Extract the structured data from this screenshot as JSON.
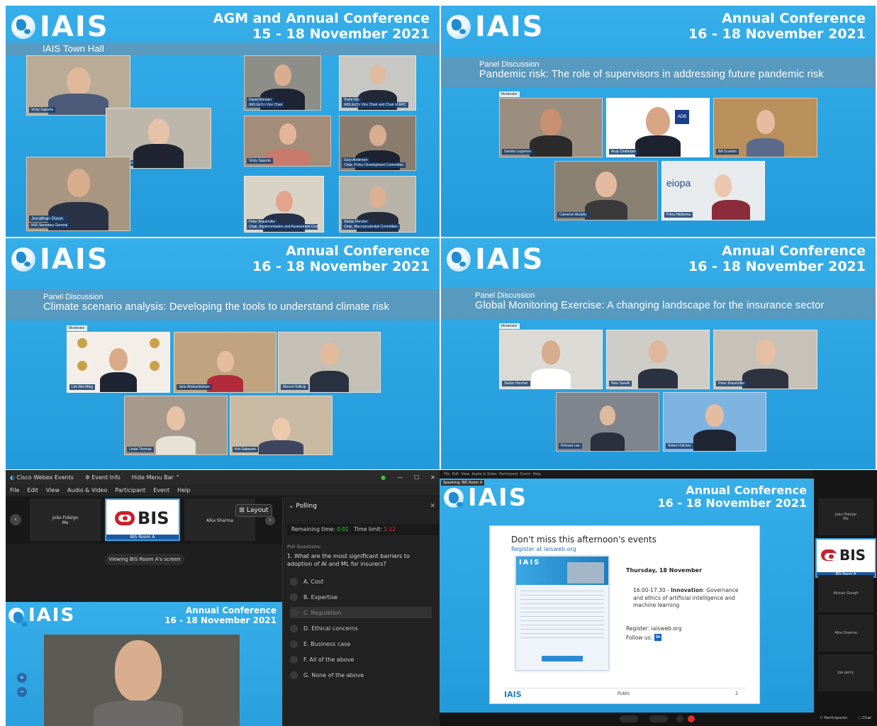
{
  "colors": {
    "brand_blue": "#2fa6e4",
    "caption_blue": "#143c6e",
    "bis_red": "#c8202c",
    "webex_dark": "#1e1e1e"
  },
  "logo": "IAIS",
  "panels": [
    {
      "conf_line1": "AGM and Annual Conference",
      "conf_line2": "15 - 18 November 2021",
      "band_title": "IAIS Town Hall",
      "tiles": [
        {
          "cap": "Vicky Saporta"
        },
        {
          "cap": "Rutger Zijlstra"
        },
        {
          "cap": "Jonathan Dixon",
          "cap2": "IAIS Secretary General"
        },
        {
          "cap": "David Altmaier",
          "cap2": "IAIS ExCo Vice Chair"
        },
        {
          "cap": "Yoshi Ota",
          "cap2": "IAIS ExCo Vice Chair and Chair of ARC"
        },
        {
          "cap": "Vicky Saporta"
        },
        {
          "cap": "Gary Anderson",
          "cap2": "Chair, Policy Development Committee"
        },
        {
          "cap": "Peter Braumüller",
          "cap2": "Chair, Implementation and Assessment Committee"
        },
        {
          "cap": "Stefan Hercher",
          "cap2": "Chair, Macroprudential Committee"
        }
      ]
    },
    {
      "conf_line1": "Annual Conference",
      "conf_line2": "16 - 18 November 2021",
      "kicker": "Panel Discussion",
      "band_title": "Pandemic risk: The role of supervisors in addressing future pandemic risk",
      "moderator": "Moderator",
      "tiles": [
        {
          "cap": "Sandra Legemon"
        },
        {
          "cap": "Arup Chatterjee"
        },
        {
          "cap": "Bill Scanlon"
        },
        {
          "cap": "Cameron Murphy"
        },
        {
          "cap": "Petra Hielkema"
        }
      ],
      "logos": [
        "ADB",
        "eiopa"
      ]
    },
    {
      "conf_line1": "Annual Conference",
      "conf_line2": "16 - 18 November 2021",
      "kicker": "Panel Discussion",
      "band_title": "Climate scenario analysis: Developing the tools to understand climate risk",
      "moderator": "Moderator",
      "tiles": [
        {
          "cap": "Lim Wei Ming"
        },
        {
          "cap": "Jane Ambachtsheer"
        },
        {
          "cap": "Marcel Holtrop"
        },
        {
          "cap": "Linda Thomas"
        },
        {
          "cap": "Kris Sabourin"
        }
      ]
    },
    {
      "conf_line1": "Annual Conference",
      "conf_line2": "16 - 18 November 2021",
      "kicker": "Panel Discussion",
      "band_title": "Global Monitoring Exercise: A changing landscape for the insurance sector",
      "moderator": "Moderator",
      "tiles": [
        {
          "cap": "Stefan Hercher"
        },
        {
          "cap": "Nino Savelli"
        },
        {
          "cap": "Peter Braumüller"
        },
        {
          "cap": "Richard Lee"
        },
        {
          "cap": "Robert Kitchen"
        }
      ]
    }
  ],
  "webex": {
    "app": "Cisco Webex Events",
    "event_info": "Event Info",
    "hide_menu": "Hide Menu Bar",
    "menu": [
      "File",
      "Edit",
      "View",
      "Audio & Video",
      "Participant",
      "Event",
      "Help"
    ],
    "participant1": "João Fidalgo",
    "participant1_sub": "Me",
    "bis_label": "BIS",
    "bis_room": "BIS Room A",
    "participant3": "Alka Sharma",
    "layout_btn": "Layout",
    "viewing": "Viewing BIS Room A's screen",
    "share_conf1": "Annual Conference",
    "share_conf2": "16 - 18 November 2021",
    "polling": {
      "title": "Polling",
      "remaining": "Remaining time:",
      "remaining_val": "0:01",
      "limit": "Time limit:",
      "limit_val": "1:12",
      "section": "Poll Questions:",
      "question": "1.  What are the most significant barriers to adoption of AI and ML for insurers?",
      "options": [
        "A.  Cost",
        "B.  Expertise",
        "C.  Regulation",
        "D.  Ethical concerns",
        "E.  Business case",
        "F.  All of the above",
        "G.  None of the above"
      ]
    }
  },
  "slide": {
    "speaking": "Speaking: BIS Room A",
    "conf1": "Annual Conference",
    "conf2": "16 - 18 November 2021",
    "heading": "Don't miss this afternoon's events",
    "register_link": "Register at iaisweb.org",
    "date": "Thursday, 18 November",
    "session_time": "16.00-17.30 -",
    "session_name": "Innovation",
    "session_desc": ": Governance and ethics of artificial intelligence and machine learning",
    "register2": "Register: iaisweb.org",
    "follow": "Follow us:",
    "footer_public": "Public",
    "footer_page": "2",
    "side": [
      "João Fidalgo",
      "Me",
      "BIS",
      "BIS Room A",
      "Alistair Gough",
      "Alka Sharma",
      "Joe perry"
    ],
    "bottom_bar": [
      "Participants",
      "Chat"
    ]
  }
}
